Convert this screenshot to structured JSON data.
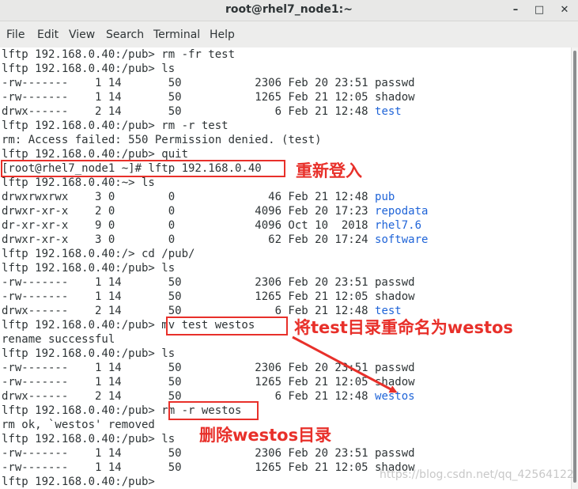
{
  "window": {
    "title": "root@rhel7_node1:~",
    "minimize_glyph": "–",
    "maximize_glyph": "□",
    "close_glyph": "✕"
  },
  "menu": [
    "File",
    "Edit",
    "View",
    "Search",
    "Terminal",
    "Help"
  ],
  "terminal": {
    "lines": [
      [
        {
          "t": "lftp 192.168.0.40:/pub> rm -fr test"
        }
      ],
      [
        {
          "t": "lftp 192.168.0.40:/pub> ls"
        }
      ],
      [
        {
          "t": "-rw-------    1 14       50           2306 Feb 20 23:51 passwd"
        }
      ],
      [
        {
          "t": "-rw-------    1 14       50           1265 Feb 21 12:05 shadow"
        }
      ],
      [
        {
          "t": "drwx------    2 14       50              6 Feb 21 12:48 "
        },
        {
          "t": "test",
          "c": "blue"
        }
      ],
      [
        {
          "t": "lftp 192.168.0.40:/pub> rm -r test"
        }
      ],
      [
        {
          "t": "rm: Access failed: 550 Permission denied. (test)"
        }
      ],
      [
        {
          "t": "lftp 192.168.0.40:/pub> quit"
        }
      ],
      [
        {
          "t": "[root@rhel7_node1 ~]# lftp 192.168.0.40"
        }
      ],
      [
        {
          "t": "lftp 192.168.0.40:~> ls"
        }
      ],
      [
        {
          "t": "drwxrwxrwx    3 0        0              46 Feb 21 12:48 "
        },
        {
          "t": "pub",
          "c": "blue"
        }
      ],
      [
        {
          "t": "drwxr-xr-x    2 0        0            4096 Feb 20 17:23 "
        },
        {
          "t": "repodata",
          "c": "blue"
        }
      ],
      [
        {
          "t": "dr-xr-xr-x    9 0        0            4096 Oct 10  2018 "
        },
        {
          "t": "rhel7.6",
          "c": "blue"
        }
      ],
      [
        {
          "t": "drwxr-xr-x    3 0        0              62 Feb 20 17:24 "
        },
        {
          "t": "software",
          "c": "blue"
        }
      ],
      [
        {
          "t": "lftp 192.168.0.40:/> cd /pub/"
        }
      ],
      [
        {
          "t": "lftp 192.168.0.40:/pub> ls"
        }
      ],
      [
        {
          "t": "-rw-------    1 14       50           2306 Feb 20 23:51 passwd"
        }
      ],
      [
        {
          "t": "-rw-------    1 14       50           1265 Feb 21 12:05 shadow"
        }
      ],
      [
        {
          "t": "drwx------    2 14       50              6 Feb 21 12:48 "
        },
        {
          "t": "test",
          "c": "blue"
        }
      ],
      [
        {
          "t": "lftp 192.168.0.40:/pub> mv test westos"
        }
      ],
      [
        {
          "t": "rename successful"
        }
      ],
      [
        {
          "t": "lftp 192.168.0.40:/pub> ls"
        }
      ],
      [
        {
          "t": "-rw-------    1 14       50           2306 Feb 20 23:51 passwd"
        }
      ],
      [
        {
          "t": "-rw-------    1 14       50           1265 Feb 21 12:05 shadow"
        }
      ],
      [
        {
          "t": "drwx------    2 14       50              6 Feb 21 12:48 "
        },
        {
          "t": "westos",
          "c": "blue"
        }
      ],
      [
        {
          "t": "lftp 192.168.0.40:/pub> rm -r westos"
        }
      ],
      [
        {
          "t": "rm ok, `westos' removed"
        }
      ],
      [
        {
          "t": "lftp 192.168.0.40:/pub> ls"
        }
      ],
      [
        {
          "t": "-rw-------    1 14       50           2306 Feb 20 23:51 passwd"
        }
      ],
      [
        {
          "t": "-rw-------    1 14       50           1265 Feb 21 12:05 shadow"
        }
      ],
      [
        {
          "t": "lftp 192.168.0.40:/pub> "
        }
      ]
    ]
  },
  "annotations": {
    "relogin": "重新登入",
    "rename": "将test目录重命名为westos",
    "delete": "删除westos目录",
    "color": "#e8302a"
  },
  "watermark": "https://blog.csdn.net/qq_42564122"
}
